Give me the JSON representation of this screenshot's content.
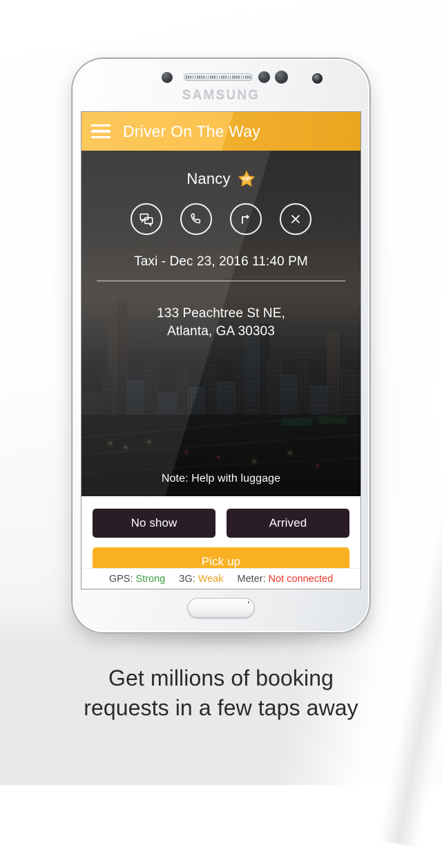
{
  "device": {
    "brand": "SAMSUNG"
  },
  "app": {
    "header": {
      "title": "Driver On The Way",
      "menu_icon": "hamburger-menu-icon",
      "background_color": "#fbb830"
    },
    "trip": {
      "passenger_name": "Nancy",
      "vip_badge_text": "VIP",
      "actions": [
        {
          "name": "message",
          "icon": "chat-bubbles-icon"
        },
        {
          "name": "call",
          "icon": "phone-icon"
        },
        {
          "name": "navigate",
          "icon": "turn-right-arrow-icon"
        },
        {
          "name": "cancel",
          "icon": "close-x-icon"
        }
      ],
      "meta_line": "Taxi - Dec 23, 2016 11:40 PM",
      "address_line_1": "133 Peachtree St NE,",
      "address_line_2": "Atlanta, GA 30303",
      "note": "Note: Help with luggage"
    },
    "buttons": {
      "no_show": "No show",
      "arrived": "Arrived",
      "pick_up": "Pick up",
      "dark_color": "#2a1d27",
      "primary_color": "#f9b123"
    },
    "status_bar": [
      {
        "label": "GPS:",
        "value": "Strong",
        "color": "#3aa03a"
      },
      {
        "label": "3G:",
        "value": "Weak",
        "color": "#e8a020"
      },
      {
        "label": "Meter:",
        "value": "Not connected",
        "color": "#e8352b"
      }
    ]
  },
  "caption": {
    "line_1": "Get millions of booking",
    "line_2": "requests in a few taps away"
  }
}
